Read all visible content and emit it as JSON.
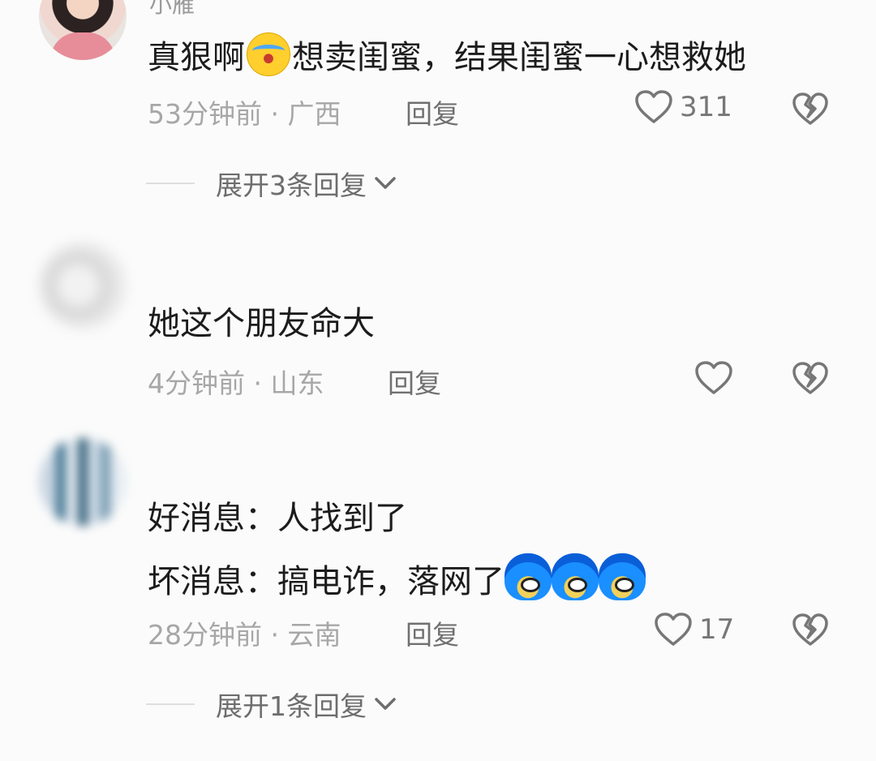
{
  "comments": [
    {
      "username": "小雁",
      "text_before": "真狠啊",
      "emoji_1": "crying-laughing-emoji",
      "text_after": "想卖闺蜜，结果闺蜜一心想救她",
      "meta": "53分钟前 · 广西",
      "reply_label": "回复",
      "like_count": "311",
      "expand_label": "展开3条回复"
    },
    {
      "username": "",
      "text": "她这个朋友命大",
      "meta": "4分钟前 · 山东",
      "reply_label": "回复",
      "like_count": ""
    },
    {
      "username": "",
      "line_1": "好消息：人找到了",
      "line_2": "坏消息：搞电诈，落网了",
      "emoji_3": "blue-hair-face-emoji",
      "meta": "28分钟前 · 云南",
      "reply_label": "回复",
      "like_count": "17",
      "expand_label": "展开1条回复"
    }
  ],
  "colors": {
    "background": "#fbfbfb",
    "text": "#1c1c1c",
    "meta": "#a7a7a7",
    "icon": "#777777"
  }
}
